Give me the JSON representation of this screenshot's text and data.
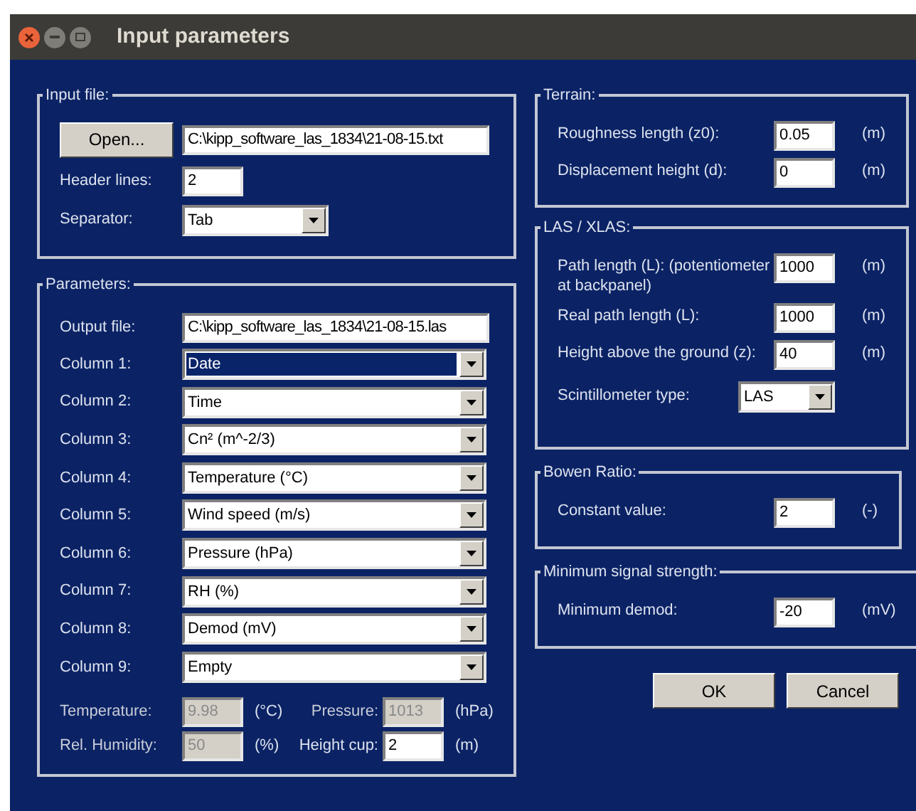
{
  "window": {
    "title": "Input parameters"
  },
  "input_file": {
    "title": "Input file:",
    "open_button": "Open...",
    "path": "C:\\kipp_software_las_1834\\21-08-15.txt",
    "header_lines_label": "Header lines:",
    "header_lines": "2",
    "separator_label": "Separator:",
    "separator": "Tab"
  },
  "parameters": {
    "title": "Parameters:",
    "output_file_label": "Output file:",
    "output_file": "C:\\kipp_software_las_1834\\21-08-15.las",
    "columns": [
      {
        "label": "Column 1:",
        "value": "Date",
        "focused": true
      },
      {
        "label": "Column 2:",
        "value": "Time",
        "focused": false
      },
      {
        "label": "Column 3:",
        "value": "Cn² (m^-2/3)",
        "focused": false
      },
      {
        "label": "Column 4:",
        "value": "Temperature (°C)",
        "focused": false
      },
      {
        "label": "Column 5:",
        "value": "Wind speed (m/s)",
        "focused": false
      },
      {
        "label": "Column 6:",
        "value": "Pressure (hPa)",
        "focused": false
      },
      {
        "label": "Column 7:",
        "value": "RH (%)",
        "focused": false
      },
      {
        "label": "Column 8:",
        "value": "Demod (mV)",
        "focused": false
      },
      {
        "label": "Column 9:",
        "value": "Empty",
        "focused": false
      }
    ],
    "constants": [
      {
        "label": "Temperature:",
        "value": "9.98",
        "unit": "(°C)",
        "disabled": true
      },
      {
        "label": "Pressure:",
        "value": "1013",
        "unit": "(hPa)",
        "disabled": true
      },
      {
        "label": "Rel. Humidity:",
        "value": "50",
        "unit": "(%)",
        "disabled": true
      },
      {
        "label": "Height cup:",
        "value": "2",
        "unit": "(m)",
        "disabled": false
      }
    ]
  },
  "terrain": {
    "title": "Terrain:",
    "rows": [
      {
        "label": "Roughness length (z0):",
        "value": "0.05",
        "unit": "(m)"
      },
      {
        "label": "Displacement height (d):",
        "value": "0",
        "unit": "(m)"
      }
    ]
  },
  "las": {
    "title": "LAS / XLAS:",
    "rows": [
      {
        "label": "Path length (L): (potentiometer at backpanel)",
        "value": "1000",
        "unit": "(m)"
      },
      {
        "label": "Real path length (L):",
        "value": "1000",
        "unit": "(m)"
      },
      {
        "label": "Height above the ground (z):",
        "value": "40",
        "unit": "(m)"
      }
    ],
    "scintillometer_label": "Scintillometer type:",
    "scintillometer": "LAS"
  },
  "bowen_ratio": {
    "title": "Bowen Ratio:",
    "rows": [
      {
        "label": "Constant value:",
        "value": "2",
        "unit": "(-)"
      }
    ]
  },
  "minimum_signal": {
    "title": "Minimum signal strength:",
    "rows": [
      {
        "label": "Minimum demod:",
        "value": "-20",
        "unit": "(mV)"
      }
    ]
  },
  "buttons": [
    "OK",
    "Cancel"
  ]
}
